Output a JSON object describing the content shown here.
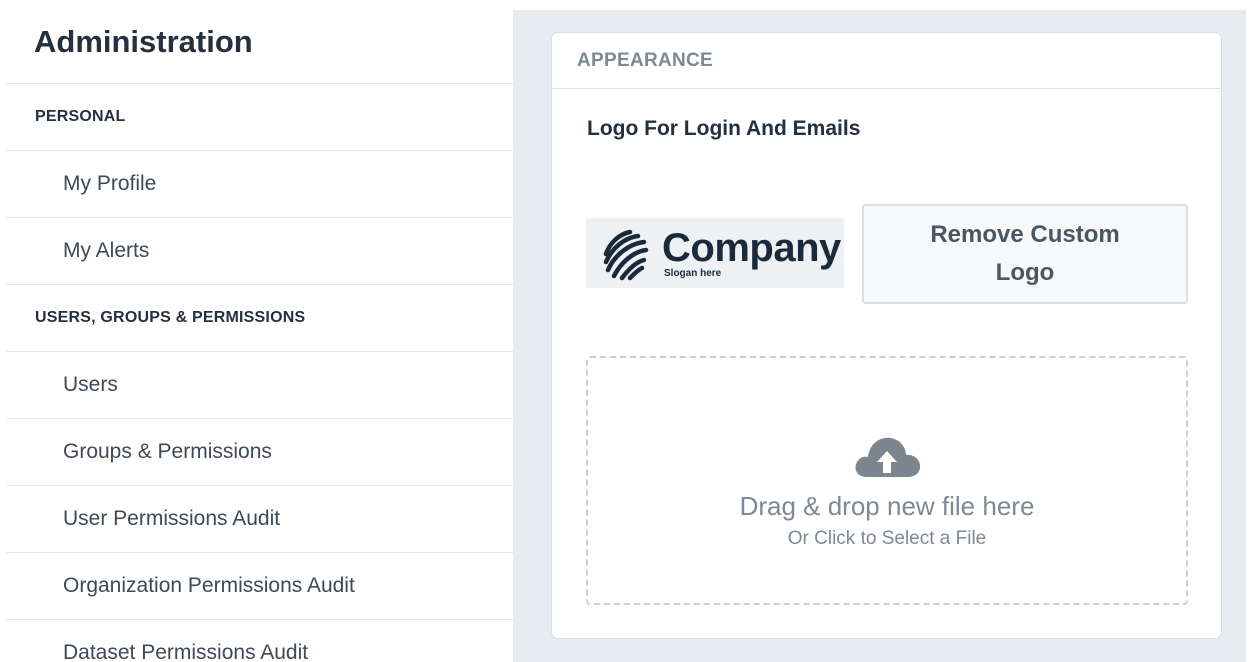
{
  "sidebar": {
    "title": "Administration",
    "sections": [
      {
        "header": "PERSONAL",
        "items": [
          "My Profile",
          "My Alerts"
        ]
      },
      {
        "header": "USERS, GROUPS & PERMISSIONS",
        "items": [
          "Users",
          "Groups & Permissions",
          "User Permissions Audit",
          "Organization Permissions Audit",
          "Dataset Permissions Audit"
        ]
      }
    ]
  },
  "panel": {
    "header": "APPEARANCE",
    "section_title": "Logo For Login And Emails",
    "logo": {
      "name": "Company",
      "slogan": "Slogan here"
    },
    "remove_button_label": "Remove Custom Logo",
    "dropzone": {
      "primary": "Drag & drop new file here",
      "secondary": "Or Click to Select a File",
      "icon": "cloud-upload-icon"
    }
  },
  "colors": {
    "main_bg": "#e7ebef",
    "text_dark": "#23313f",
    "muted": "#7d8a96",
    "icon_gray": "#7b8690"
  }
}
